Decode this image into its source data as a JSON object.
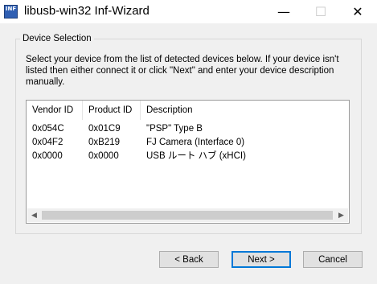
{
  "window": {
    "title": "libusb-win32 Inf-Wizard",
    "app_icon_text": "INF",
    "minimize_glyph": "—",
    "maximize_glyph": "☐",
    "close_glyph": "✕"
  },
  "group": {
    "legend": "Device Selection",
    "instructions": "Select your device from the list of detected devices below. If your device isn't listed then either connect it or click \"Next\" and enter your device description manually."
  },
  "list": {
    "columns": [
      "Vendor ID",
      "Product ID",
      "Description"
    ],
    "rows": [
      [
        "0x054C",
        "0x01C9",
        "\"PSP\" Type B"
      ],
      [
        "0x04F2",
        "0xB219",
        "FJ Camera (Interface 0)"
      ],
      [
        "0x0000",
        "0x0000",
        "USB ルート ハブ (xHCI)"
      ]
    ],
    "scroll_left_glyph": "◀",
    "scroll_right_glyph": "▶"
  },
  "buttons": {
    "back": "< Back",
    "next": "Next >",
    "cancel": "Cancel"
  }
}
